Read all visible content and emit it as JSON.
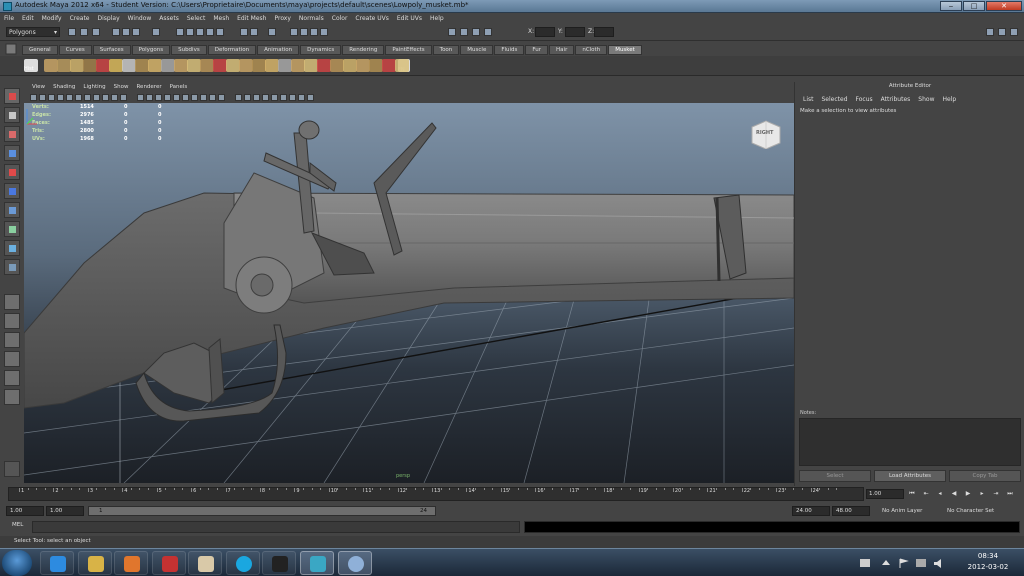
{
  "window": {
    "title": "Autodesk Maya 2012 x64 - Student Version: C:\\Users\\Proprietaire\\Documents\\maya\\projects\\default\\scenes\\Lowpoly_musket.mb*"
  },
  "menubar": [
    "File",
    "Edit",
    "Modify",
    "Create",
    "Display",
    "Window",
    "Assets",
    "Select",
    "Mesh",
    "Edit Mesh",
    "Proxy",
    "Normals",
    "Color",
    "Create UVs",
    "Edit UVs",
    "Help"
  ],
  "status_line": {
    "mode": "Polygons",
    "x_label": "X:",
    "y_label": "Y:",
    "z_label": "Z:"
  },
  "shelf_tabs": [
    "General",
    "Curves",
    "Surfaces",
    "Polygons",
    "Subdivs",
    "Deformation",
    "Animation",
    "Dynamics",
    "Rendering",
    "PaintEffects",
    "Toon",
    "Muscle",
    "Fluids",
    "Fur",
    "Hair",
    "nCloth",
    "Musket"
  ],
  "shelf_active": "Musket",
  "shelf": {
    "hist_label": "Hist",
    "fn_label": "FN"
  },
  "panel_menu": [
    "View",
    "Shading",
    "Lighting",
    "Show",
    "Renderer",
    "Panels"
  ],
  "hud": [
    {
      "label": "Verts:",
      "value": "1514",
      "sel": "0",
      "sel2": "0"
    },
    {
      "label": "Edges:",
      "value": "2976",
      "sel": "0",
      "sel2": "0"
    },
    {
      "label": "Faces:",
      "value": "1485",
      "sel": "0",
      "sel2": "0"
    },
    {
      "label": "Tris:",
      "value": "2800",
      "sel": "0",
      "sel2": "0"
    },
    {
      "label": "UVs:",
      "value": "1968",
      "sel": "0",
      "sel2": "0"
    }
  ],
  "viewcube": {
    "face": "RIGHT"
  },
  "viewport": {
    "camera": "persp"
  },
  "attribute_editor": {
    "title": "Attribute Editor",
    "menu": [
      "List",
      "Selected",
      "Focus",
      "Attributes",
      "Show",
      "Help"
    ],
    "message": "Make a selection to view attributes",
    "notes_label": "Notes:",
    "buttons": [
      "Select",
      "Load Attributes",
      "Copy Tab"
    ]
  },
  "timeline": {
    "ticks": [
      "1",
      "2",
      "3",
      "4",
      "5",
      "6",
      "7",
      "8",
      "9",
      "10",
      "11",
      "12",
      "13",
      "14",
      "15",
      "16",
      "17",
      "18",
      "19",
      "20",
      "21",
      "22",
      "23",
      "24"
    ],
    "current_frame": "1.00"
  },
  "range": {
    "start": "1.00",
    "inner_start": "1.00",
    "slider_start": "1",
    "slider_end": "24",
    "end": "24.00",
    "outer_end": "48.00",
    "anim_layer": "No Anim Layer",
    "character_set": "No Character Set"
  },
  "mel": {
    "label": "MEL"
  },
  "help_line": "Select Tool: select an object",
  "taskbar": {
    "time": "08:34",
    "date": "2012-03-02"
  }
}
